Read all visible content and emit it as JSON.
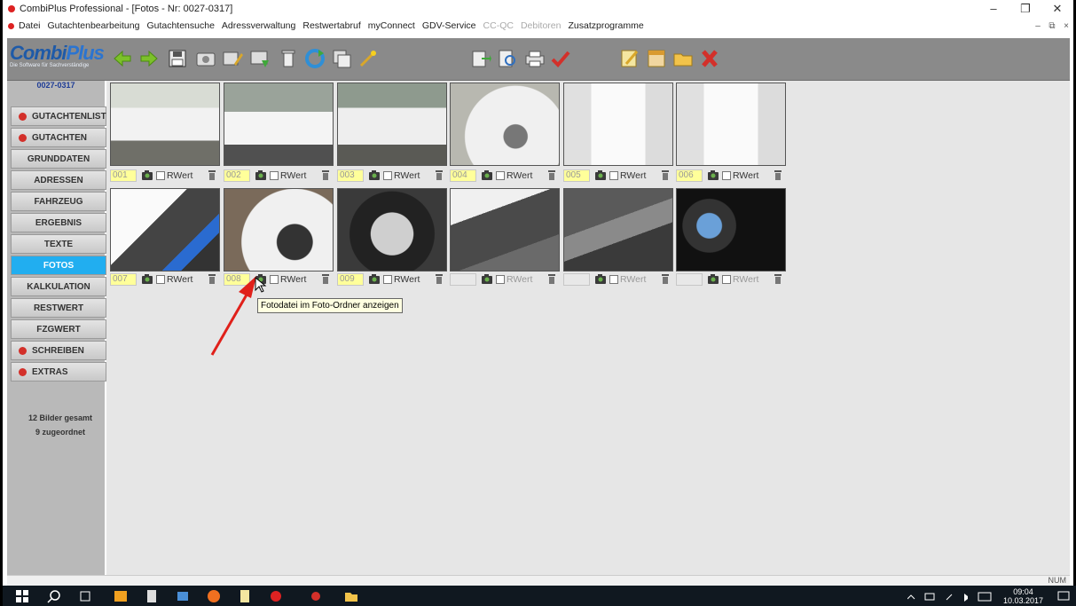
{
  "window": {
    "title": "CombiPlus Professional - [Fotos - Nr: 0027-0317]",
    "minimize": "–",
    "restore": "❐",
    "close": "✕"
  },
  "menu": {
    "items": [
      "Datei",
      "Gutachtenbearbeitung",
      "Gutachtensuche",
      "Adressverwaltung",
      "Restwertabruf",
      "myConnect",
      "GDV-Service"
    ],
    "disabled_items": [
      "CC-QC",
      "Debitoren"
    ],
    "last_item": "Zusatzprogramme",
    "mdi": [
      "–",
      "⧉",
      "×"
    ]
  },
  "logo": {
    "brand_part1": "Combi",
    "brand_part2": "Plus",
    "tagline": "Die Software für Sachverständige"
  },
  "sidebar": {
    "case_number": "0027-0317",
    "items": [
      {
        "label": "GUTACHTENLISTE",
        "dot": true
      },
      {
        "label": "GUTACHTEN",
        "dot": true
      },
      {
        "label": "GRUNDDATEN",
        "dot": false
      },
      {
        "label": "ADRESSEN",
        "dot": false
      },
      {
        "label": "FAHRZEUG",
        "dot": false
      },
      {
        "label": "ERGEBNIS",
        "dot": false
      },
      {
        "label": "TEXTE",
        "dot": false
      },
      {
        "label": "FOTOS",
        "dot": false,
        "active": true
      },
      {
        "label": "KALKULATION",
        "dot": false
      },
      {
        "label": "RESTWERT",
        "dot": false
      },
      {
        "label": "FZGWERT",
        "dot": false
      },
      {
        "label": "SCHREIBEN",
        "dot": true
      },
      {
        "label": "EXTRAS",
        "dot": true
      }
    ],
    "stats_total": "12 Bilder gesamt",
    "stats_assigned": "9 zugeordnet"
  },
  "photos": {
    "rwert_label": "RWert",
    "row1": [
      "001",
      "002",
      "003",
      "004",
      "005",
      "006"
    ],
    "row2": [
      "007",
      "008",
      "009",
      "",
      "",
      ""
    ]
  },
  "tooltip": "Fotodatei im Foto-Ordner anzeigen",
  "statusbar": {
    "num": "NUM"
  },
  "taskbar": {
    "time": "09:04",
    "date": "10.03.2017"
  },
  "colors": {
    "active_nav": "#21aef0",
    "toolbar": "#8a8a8a",
    "sidebar": "#b9b9b9",
    "number_field": "#ffff9a",
    "arrow": "#e0201a"
  }
}
